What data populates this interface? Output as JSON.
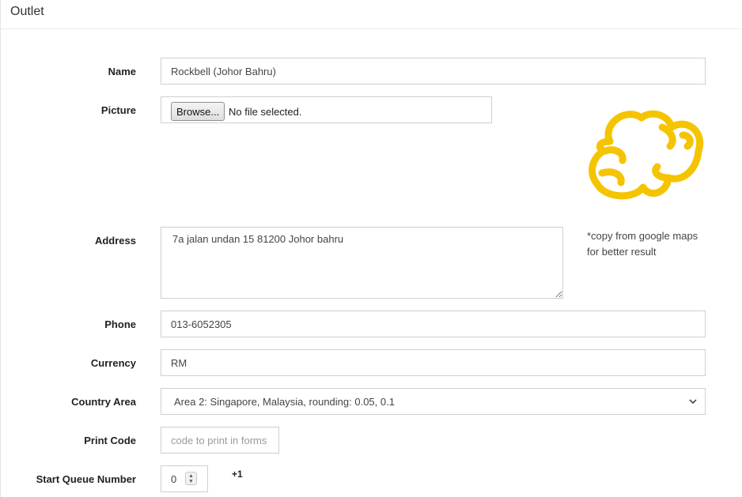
{
  "panel": {
    "title": "Outlet"
  },
  "form": {
    "name": {
      "label": "Name",
      "value": "Rockbell (Johor Bahru)"
    },
    "picture": {
      "label": "Picture",
      "browse_label": "Browse...",
      "file_status": "No file selected.",
      "logo_icon": "cloud-doodle-logo",
      "logo_color": "#F5C400"
    },
    "address": {
      "label": "Address",
      "value": "7a jalan undan 15 81200 Johor bahru",
      "hint_line1": "*copy from google maps",
      "hint_line2": "for better result"
    },
    "phone": {
      "label": "Phone",
      "value": "013-6052305"
    },
    "currency": {
      "label": "Currency",
      "value": "RM"
    },
    "country_area": {
      "label": "Country Area",
      "value": "Area 2: Singapore, Malaysia, rounding: 0.05, 0.1",
      "icon": "chevron-down-icon"
    },
    "print_code": {
      "label": "Print Code",
      "placeholder": "code to print in forms"
    },
    "start_queue": {
      "label": "Start Queue Number",
      "value": "0",
      "increment_label": "+1"
    }
  }
}
